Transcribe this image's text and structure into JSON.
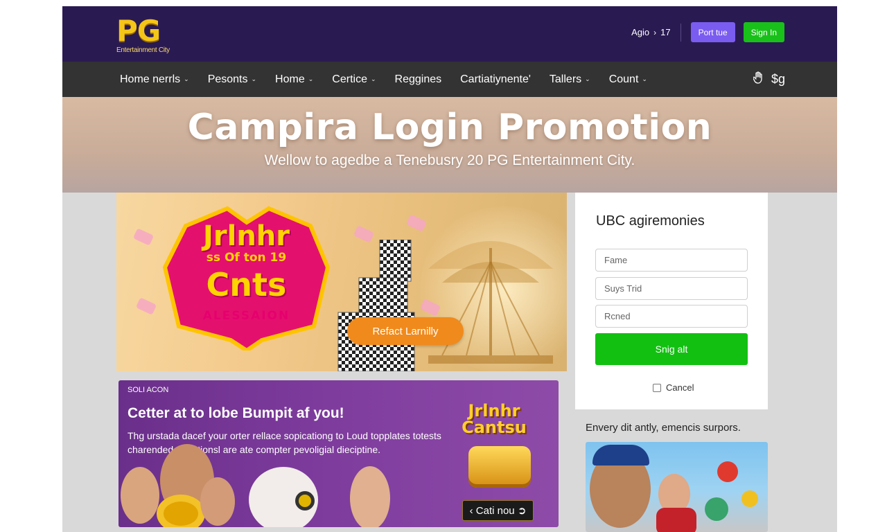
{
  "header": {
    "logo_mark": "PG",
    "logo_sub": "Entertainment City",
    "lang_label": "Agio",
    "lang_code": "17",
    "btn_primary": "Port tue",
    "btn_signin": "Sign In"
  },
  "nav": {
    "items": [
      {
        "label": "Home nerrls"
      },
      {
        "label": "Pesonts"
      },
      {
        "label": "Home"
      },
      {
        "label": "Certice"
      },
      {
        "label": "Reggines"
      },
      {
        "label": "Cartiatiynente'"
      },
      {
        "label": "Tallers"
      },
      {
        "label": "Count"
      }
    ],
    "right_label": "$g"
  },
  "hero": {
    "title": "Campira Login Promotion",
    "subtitle": "Wellow to agedbe a Tenebusry 20 PG Entertainment City."
  },
  "banner": {
    "badge_line1": "Jrlnhr",
    "badge_line2": "ss Of ton 19",
    "badge_line3": "Cnts",
    "badge_line4": "ALESSAION",
    "cta": "Refact Larnilly"
  },
  "promo": {
    "tag": "SOLI ACON",
    "title": "Cetter at to lobe Bumpit af you!",
    "description": "Thg urstada dacef your orter rellace sopicationg to Loud topplates totests charended apantionsl are ate compter pevoligial dieciptine.",
    "logo_line1": "Jrlnhr",
    "logo_line2": "Cantsu",
    "cta": "Cati nou"
  },
  "login": {
    "title": "UBC agiremonies",
    "field1_placeholder": "Fame",
    "field2_placeholder": "Suys Trid",
    "field3_placeholder": "Rcned",
    "submit": "Snig alt",
    "cancel": "Cancel"
  },
  "sidebar": {
    "caption": "Envery dit antly, emencis surpors."
  },
  "colors": {
    "header_bg": "#2a1a52",
    "nav_bg": "#333333",
    "accent_purple": "#7b5cf0",
    "accent_green": "#19c019",
    "cta_orange": "#f08a1c",
    "logo_gold": "#f5c518"
  }
}
